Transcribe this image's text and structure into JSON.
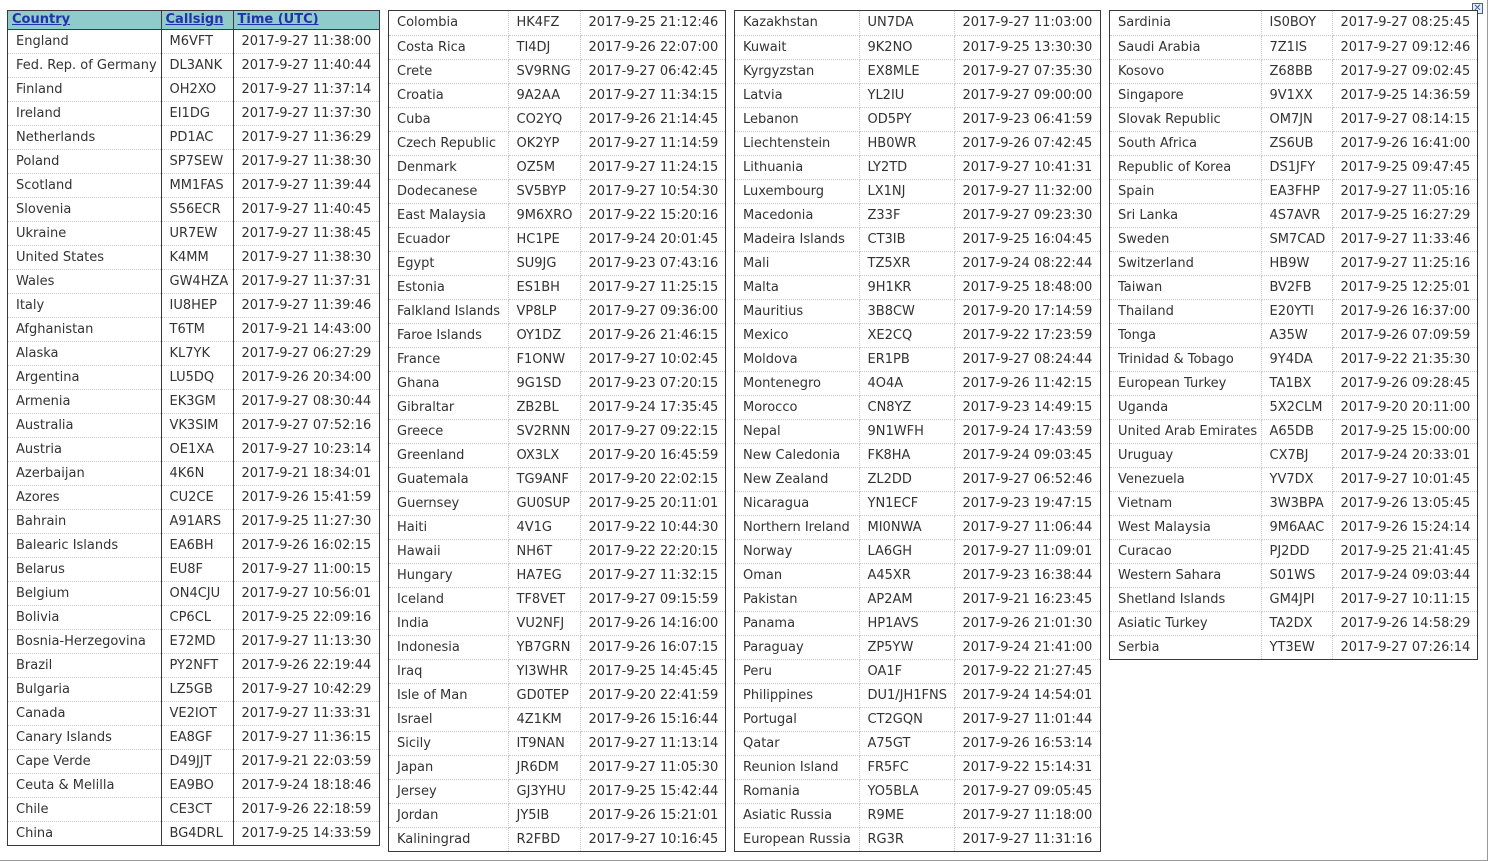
{
  "headers": {
    "country": "Country",
    "callsign": "Callsign",
    "time": "Time (UTC)"
  },
  "close_icon": "close-icon",
  "columns": [
    [
      [
        "England",
        "M6VFT",
        "2017-9-27 11:38:00"
      ],
      [
        "Fed. Rep. of Germany",
        "DL3ANK",
        "2017-9-27 11:40:44"
      ],
      [
        "Finland",
        "OH2XO",
        "2017-9-27 11:37:14"
      ],
      [
        "Ireland",
        "EI1DG",
        "2017-9-27 11:37:30"
      ],
      [
        "Netherlands",
        "PD1AC",
        "2017-9-27 11:36:29"
      ],
      [
        "Poland",
        "SP7SEW",
        "2017-9-27 11:38:30"
      ],
      [
        "Scotland",
        "MM1FAS",
        "2017-9-27 11:39:44"
      ],
      [
        "Slovenia",
        "S56ECR",
        "2017-9-27 11:40:45"
      ],
      [
        "Ukraine",
        "UR7EW",
        "2017-9-27 11:38:45"
      ],
      [
        "United States",
        "K4MM",
        "2017-9-27 11:38:30"
      ],
      [
        "Wales",
        "GW4HZA",
        "2017-9-27 11:37:31"
      ],
      [
        "Italy",
        "IU8HEP",
        "2017-9-27 11:39:46"
      ],
      [
        "Afghanistan",
        "T6TM",
        "2017-9-21 14:43:00"
      ],
      [
        "Alaska",
        "KL7YK",
        "2017-9-27 06:27:29"
      ],
      [
        "Argentina",
        "LU5DQ",
        "2017-9-26 20:34:00"
      ],
      [
        "Armenia",
        "EK3GM",
        "2017-9-27 08:30:44"
      ],
      [
        "Australia",
        "VK3SIM",
        "2017-9-27 07:52:16"
      ],
      [
        "Austria",
        "OE1XA",
        "2017-9-27 10:23:14"
      ],
      [
        "Azerbaijan",
        "4K6N",
        "2017-9-21 18:34:01"
      ],
      [
        "Azores",
        "CU2CE",
        "2017-9-26 15:41:59"
      ],
      [
        "Bahrain",
        "A91ARS",
        "2017-9-25 11:27:30"
      ],
      [
        "Balearic Islands",
        "EA6BH",
        "2017-9-26 16:02:15"
      ],
      [
        "Belarus",
        "EU8F",
        "2017-9-27 11:00:15"
      ],
      [
        "Belgium",
        "ON4CJU",
        "2017-9-27 10:56:01"
      ],
      [
        "Bolivia",
        "CP6CL",
        "2017-9-25 22:09:16"
      ],
      [
        "Bosnia-Herzegovina",
        "E72MD",
        "2017-9-27 11:13:30"
      ],
      [
        "Brazil",
        "PY2NFT",
        "2017-9-26 22:19:44"
      ],
      [
        "Bulgaria",
        "LZ5GB",
        "2017-9-27 10:42:29"
      ],
      [
        "Canada",
        "VE2IOT",
        "2017-9-27 11:33:31"
      ],
      [
        "Canary Islands",
        "EA8GF",
        "2017-9-27 11:36:15"
      ],
      [
        "Cape Verde",
        "D49JJT",
        "2017-9-21 22:03:59"
      ],
      [
        "Ceuta & Melilla",
        "EA9BO",
        "2017-9-24 18:18:46"
      ],
      [
        "Chile",
        "CE3CT",
        "2017-9-26 22:18:59"
      ],
      [
        "China",
        "BG4DRL",
        "2017-9-25 14:33:59"
      ]
    ],
    [
      [
        "Colombia",
        "HK4FZ",
        "2017-9-25 21:12:46"
      ],
      [
        "Costa Rica",
        "TI4DJ",
        "2017-9-26 22:07:00"
      ],
      [
        "Crete",
        "SV9RNG",
        "2017-9-27 06:42:45"
      ],
      [
        "Croatia",
        "9A2AA",
        "2017-9-27 11:34:15"
      ],
      [
        "Cuba",
        "CO2YQ",
        "2017-9-26 21:14:45"
      ],
      [
        "Czech Republic",
        "OK2YP",
        "2017-9-27 11:14:59"
      ],
      [
        "Denmark",
        "OZ5M",
        "2017-9-27 11:24:15"
      ],
      [
        "Dodecanese",
        "SV5BYP",
        "2017-9-27 10:54:30"
      ],
      [
        "East Malaysia",
        "9M6XRO",
        "2017-9-22 15:20:16"
      ],
      [
        "Ecuador",
        "HC1PE",
        "2017-9-24 20:01:45"
      ],
      [
        "Egypt",
        "SU9JG",
        "2017-9-23 07:43:16"
      ],
      [
        "Estonia",
        "ES1BH",
        "2017-9-27 11:25:15"
      ],
      [
        "Falkland Islands",
        "VP8LP",
        "2017-9-27 09:36:00"
      ],
      [
        "Faroe Islands",
        "OY1DZ",
        "2017-9-26 21:46:15"
      ],
      [
        "France",
        "F1ONW",
        "2017-9-27 10:02:45"
      ],
      [
        "Ghana",
        "9G1SD",
        "2017-9-23 07:20:15"
      ],
      [
        "Gibraltar",
        "ZB2BL",
        "2017-9-24 17:35:45"
      ],
      [
        "Greece",
        "SV2RNN",
        "2017-9-27 09:22:15"
      ],
      [
        "Greenland",
        "OX3LX",
        "2017-9-20 16:45:59"
      ],
      [
        "Guatemala",
        "TG9ANF",
        "2017-9-20 22:02:15"
      ],
      [
        "Guernsey",
        "GU0SUP",
        "2017-9-25 20:11:01"
      ],
      [
        "Haiti",
        "4V1G",
        "2017-9-22 10:44:30"
      ],
      [
        "Hawaii",
        "NH6T",
        "2017-9-22 22:20:15"
      ],
      [
        "Hungary",
        "HA7EG",
        "2017-9-27 11:32:15"
      ],
      [
        "Iceland",
        "TF8VET",
        "2017-9-27 09:15:59"
      ],
      [
        "India",
        "VU2NFJ",
        "2017-9-26 14:16:00"
      ],
      [
        "Indonesia",
        "YB7GRN",
        "2017-9-26 16:07:15"
      ],
      [
        "Iraq",
        "YI3WHR",
        "2017-9-25 14:45:45"
      ],
      [
        "Isle of Man",
        "GD0TEP",
        "2017-9-20 22:41:59"
      ],
      [
        "Israel",
        "4Z1KM",
        "2017-9-26 15:16:44"
      ],
      [
        "Sicily",
        "IT9NAN",
        "2017-9-27 11:13:14"
      ],
      [
        "Japan",
        "JR6DM",
        "2017-9-27 11:05:30"
      ],
      [
        "Jersey",
        "GJ3YHU",
        "2017-9-25 15:42:44"
      ],
      [
        "Jordan",
        "JY5IB",
        "2017-9-26 15:21:01"
      ],
      [
        "Kaliningrad",
        "R2FBD",
        "2017-9-27 10:16:45"
      ]
    ],
    [
      [
        "Kazakhstan",
        "UN7DA",
        "2017-9-27 11:03:00"
      ],
      [
        "Kuwait",
        "9K2NO",
        "2017-9-25 13:30:30"
      ],
      [
        "Kyrgyzstan",
        "EX8MLE",
        "2017-9-27 07:35:30"
      ],
      [
        "Latvia",
        "YL2IU",
        "2017-9-27 09:00:00"
      ],
      [
        "Lebanon",
        "OD5PY",
        "2017-9-23 06:41:59"
      ],
      [
        "Liechtenstein",
        "HB0WR",
        "2017-9-26 07:42:45"
      ],
      [
        "Lithuania",
        "LY2TD",
        "2017-9-27 10:41:31"
      ],
      [
        "Luxembourg",
        "LX1NJ",
        "2017-9-27 11:32:00"
      ],
      [
        "Macedonia",
        "Z33F",
        "2017-9-27 09:23:30"
      ],
      [
        "Madeira Islands",
        "CT3IB",
        "2017-9-25 16:04:45"
      ],
      [
        "Mali",
        "TZ5XR",
        "2017-9-24 08:22:44"
      ],
      [
        "Malta",
        "9H1KR",
        "2017-9-25 18:48:00"
      ],
      [
        "Mauritius",
        "3B8CW",
        "2017-9-20 17:14:59"
      ],
      [
        "Mexico",
        "XE2CQ",
        "2017-9-22 17:23:59"
      ],
      [
        "Moldova",
        "ER1PB",
        "2017-9-27 08:24:44"
      ],
      [
        "Montenegro",
        "4O4A",
        "2017-9-26 11:42:15"
      ],
      [
        "Morocco",
        "CN8YZ",
        "2017-9-23 14:49:15"
      ],
      [
        "Nepal",
        "9N1WFH",
        "2017-9-24 17:43:59"
      ],
      [
        "New Caledonia",
        "FK8HA",
        "2017-9-24 09:03:45"
      ],
      [
        "New Zealand",
        "ZL2DD",
        "2017-9-27 06:52:46"
      ],
      [
        "Nicaragua",
        "YN1ECF",
        "2017-9-23 19:47:15"
      ],
      [
        "Northern Ireland",
        "MI0NWA",
        "2017-9-27 11:06:44"
      ],
      [
        "Norway",
        "LA6GH",
        "2017-9-27 11:09:01"
      ],
      [
        "Oman",
        "A45XR",
        "2017-9-23 16:38:44"
      ],
      [
        "Pakistan",
        "AP2AM",
        "2017-9-21 16:23:45"
      ],
      [
        "Panama",
        "HP1AVS",
        "2017-9-26 21:01:30"
      ],
      [
        "Paraguay",
        "ZP5YW",
        "2017-9-24 21:41:00"
      ],
      [
        "Peru",
        "OA1F",
        "2017-9-22 21:27:45"
      ],
      [
        "Philippines",
        "DU1/JH1FNS",
        "2017-9-24 14:54:01"
      ],
      [
        "Portugal",
        "CT2GQN",
        "2017-9-27 11:01:44"
      ],
      [
        "Qatar",
        "A75GT",
        "2017-9-26 16:53:14"
      ],
      [
        "Reunion Island",
        "FR5FC",
        "2017-9-22 15:14:31"
      ],
      [
        "Romania",
        "YO5BLA",
        "2017-9-27 09:05:45"
      ],
      [
        "Asiatic Russia",
        "R9ME",
        "2017-9-27 11:18:00"
      ],
      [
        "European Russia",
        "RG3R",
        "2017-9-27 11:31:16"
      ]
    ],
    [
      [
        "Sardinia",
        "IS0BOY",
        "2017-9-27 08:25:45"
      ],
      [
        "Saudi Arabia",
        "7Z1IS",
        "2017-9-27 09:12:46"
      ],
      [
        "Kosovo",
        "Z68BB",
        "2017-9-27 09:02:45"
      ],
      [
        "Singapore",
        "9V1XX",
        "2017-9-25 14:36:59"
      ],
      [
        "Slovak Republic",
        "OM7JN",
        "2017-9-27 08:14:15"
      ],
      [
        "South Africa",
        "ZS6UB",
        "2017-9-26 16:41:00"
      ],
      [
        "Republic of Korea",
        "DS1JFY",
        "2017-9-25 09:47:45"
      ],
      [
        "Spain",
        "EA3FHP",
        "2017-9-27 11:05:16"
      ],
      [
        "Sri Lanka",
        "4S7AVR",
        "2017-9-25 16:27:29"
      ],
      [
        "Sweden",
        "SM7CAD",
        "2017-9-27 11:33:46"
      ],
      [
        "Switzerland",
        "HB9W",
        "2017-9-27 11:25:16"
      ],
      [
        "Taiwan",
        "BV2FB",
        "2017-9-25 12:25:01"
      ],
      [
        "Thailand",
        "E20YTI",
        "2017-9-26 16:37:00"
      ],
      [
        "Tonga",
        "A35W",
        "2017-9-26 07:09:59"
      ],
      [
        "Trinidad & Tobago",
        "9Y4DA",
        "2017-9-22 21:35:30"
      ],
      [
        "European Turkey",
        "TA1BX",
        "2017-9-26 09:28:45"
      ],
      [
        "Uganda",
        "5X2CLM",
        "2017-9-20 20:11:00"
      ],
      [
        "United Arab Emirates",
        "A65DB",
        "2017-9-25 15:00:00"
      ],
      [
        "Uruguay",
        "CX7BJ",
        "2017-9-24 20:33:01"
      ],
      [
        "Venezuela",
        "YV7DX",
        "2017-9-27 10:01:45"
      ],
      [
        "Vietnam",
        "3W3BPA",
        "2017-9-26 13:05:45"
      ],
      [
        "West Malaysia",
        "9M6AAC",
        "2017-9-26 15:24:14"
      ],
      [
        "Curacao",
        "PJ2DD",
        "2017-9-25 21:41:45"
      ],
      [
        "Western Sahara",
        "S01WS",
        "2017-9-24 09:03:44"
      ],
      [
        "Shetland Islands",
        "GM4JPI",
        "2017-9-27 10:11:15"
      ],
      [
        "Asiatic Turkey",
        "TA2DX",
        "2017-9-26 14:58:29"
      ],
      [
        "Serbia",
        "YT3EW",
        "2017-9-27 07:26:14"
      ]
    ]
  ]
}
